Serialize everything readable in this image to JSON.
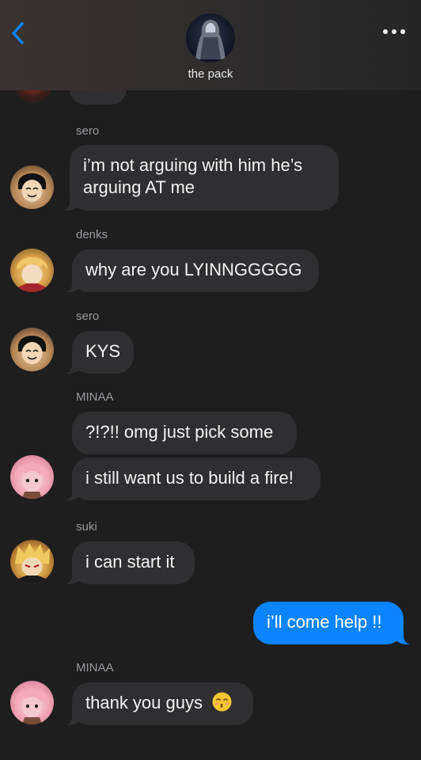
{
  "header": {
    "group_name": "the pack",
    "back_icon": "chevron-left-icon",
    "more_icon": "ellipsis-icon",
    "accent_color": "#0a84ff"
  },
  "messages": [
    {
      "sender": "sero",
      "text_line1": "i’m not arguing with him he’s",
      "text_line2": "arguing AT me",
      "avatar": "sero"
    },
    {
      "sender": "denks",
      "text": "why are you LYINNGGGGG",
      "avatar": "denks"
    },
    {
      "sender": "sero",
      "text": "KYS",
      "avatar": "sero"
    },
    {
      "sender": "MINAA",
      "text1": "?!?!! omg just pick some",
      "text2": "i still want us to build a fire!",
      "avatar": "minaa"
    },
    {
      "sender": "suki",
      "text": "i can start it",
      "avatar": "suki"
    },
    {
      "outgoing": true,
      "text": "i’ll come help !!"
    },
    {
      "sender": "MINAA",
      "text": "thank you guys",
      "emoji": "kissing-face-icon",
      "avatar": "minaa"
    }
  ],
  "colors": {
    "background": "#1e1e1f",
    "incoming_bubble": "#2f2f31",
    "outgoing_bubble": "#0a84ff",
    "sender_label": "#9a9a9e"
  }
}
